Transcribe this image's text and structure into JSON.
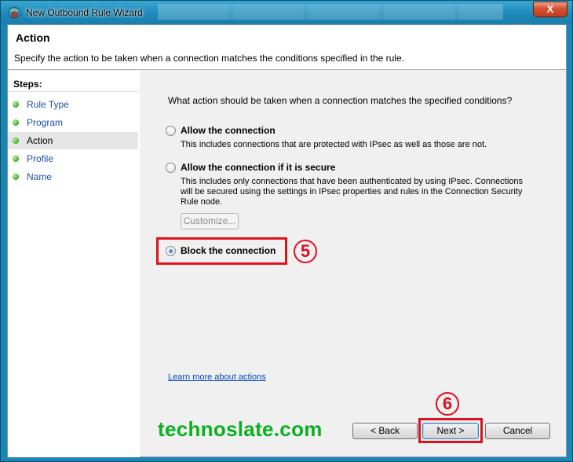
{
  "window": {
    "title": "New Outbound Rule Wizard",
    "close_label": "X"
  },
  "header": {
    "title": "Action",
    "description": "Specify the action to be taken when a connection matches the conditions specified in the rule."
  },
  "steps": {
    "label": "Steps:",
    "items": [
      {
        "label": "Rule Type"
      },
      {
        "label": "Program"
      },
      {
        "label": "Action"
      },
      {
        "label": "Profile"
      },
      {
        "label": "Name"
      }
    ],
    "active_index": 2
  },
  "main": {
    "question": "What action should be taken when a connection matches the specified conditions?",
    "options": [
      {
        "title": "Allow the connection",
        "desc": "This includes connections that are protected with IPsec as well as those are not.",
        "checked": false
      },
      {
        "title": "Allow the connection if it is secure",
        "desc_lines": [
          "This includes only connections that have been authenticated by using IPsec.  Connections",
          "will be secured using the settings in IPsec properties and rules in the Connection Security",
          "Rule node."
        ],
        "checked": false
      },
      {
        "title": "Block the connection",
        "checked": true
      }
    ],
    "customize_label": "Customize...",
    "learn_more": "Learn more about actions"
  },
  "buttons": {
    "back": "< Back",
    "next": "Next >",
    "cancel": "Cancel"
  },
  "annotations": {
    "step5": "5",
    "step6": "6",
    "highlight_color": "#e0101d"
  },
  "watermark": "technoslate.com"
}
